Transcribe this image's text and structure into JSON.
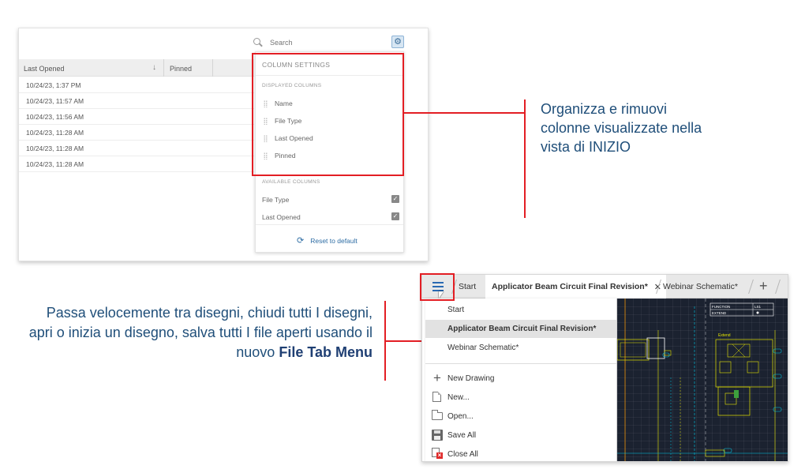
{
  "screenshot1": {
    "search_placeholder": "Search",
    "settings_icon": "gear-icon",
    "table": {
      "columns": [
        "Last Opened",
        "Pinned"
      ],
      "sort_icon": "arrow-down-icon",
      "rows": [
        "10/24/23, 1:37 PM",
        "10/24/23, 11:57 AM",
        "10/24/23, 11:56 AM",
        "10/24/23, 11:28 AM",
        "10/24/23, 11:28 AM",
        "10/24/23, 11:28 AM"
      ]
    },
    "column_settings": {
      "title": "COLUMN SETTINGS",
      "displayed_label": "DISPLAYED COLUMNS",
      "displayed": [
        "Name",
        "File Type",
        "Last Opened",
        "Pinned"
      ],
      "available_label": "AVAILABLE COLUMNS",
      "available": [
        "File Type",
        "Last Opened"
      ],
      "reset_label": "Reset to default"
    }
  },
  "callout1": {
    "text": "Organizza e rimuovi colonne visualizzate nella vista di INIZIO"
  },
  "callout2": {
    "text": "Passa velocemente tra disegni, chiudi tutti I disegni, apri o inizia un disegno, salva tutti I file aperti usando il nuovo",
    "bold": "File Tab Menu"
  },
  "screenshot2": {
    "tabs": [
      "Start",
      "Applicator Beam Circuit Final Revision*",
      "Webinar Schematic*"
    ],
    "close_glyph": "✕",
    "plus_glyph": "+",
    "menu_drawings": [
      "Start",
      "Applicator Beam Circuit Final Revision*",
      "Webinar Schematic*"
    ],
    "menu_commands": [
      {
        "label": "New Drawing",
        "icon": "plus-icon"
      },
      {
        "label": "New...",
        "icon": "document-icon"
      },
      {
        "label": "Open...",
        "icon": "folder-icon"
      },
      {
        "label": "Save All",
        "icon": "save-icon"
      },
      {
        "label": "Close All",
        "icon": "close-all-icon"
      }
    ],
    "schematic_labels": [
      "FUNCTION",
      "LS1",
      "EXTEND",
      "Extend"
    ]
  },
  "colors": {
    "callout_red": "#e31e24",
    "callout_text": "#1f4e79",
    "link_blue": "#2e6da4",
    "schematic_bg": "#1b2230",
    "schematic_yellow": "#e5e500",
    "schematic_cyan": "#00c8e6"
  }
}
